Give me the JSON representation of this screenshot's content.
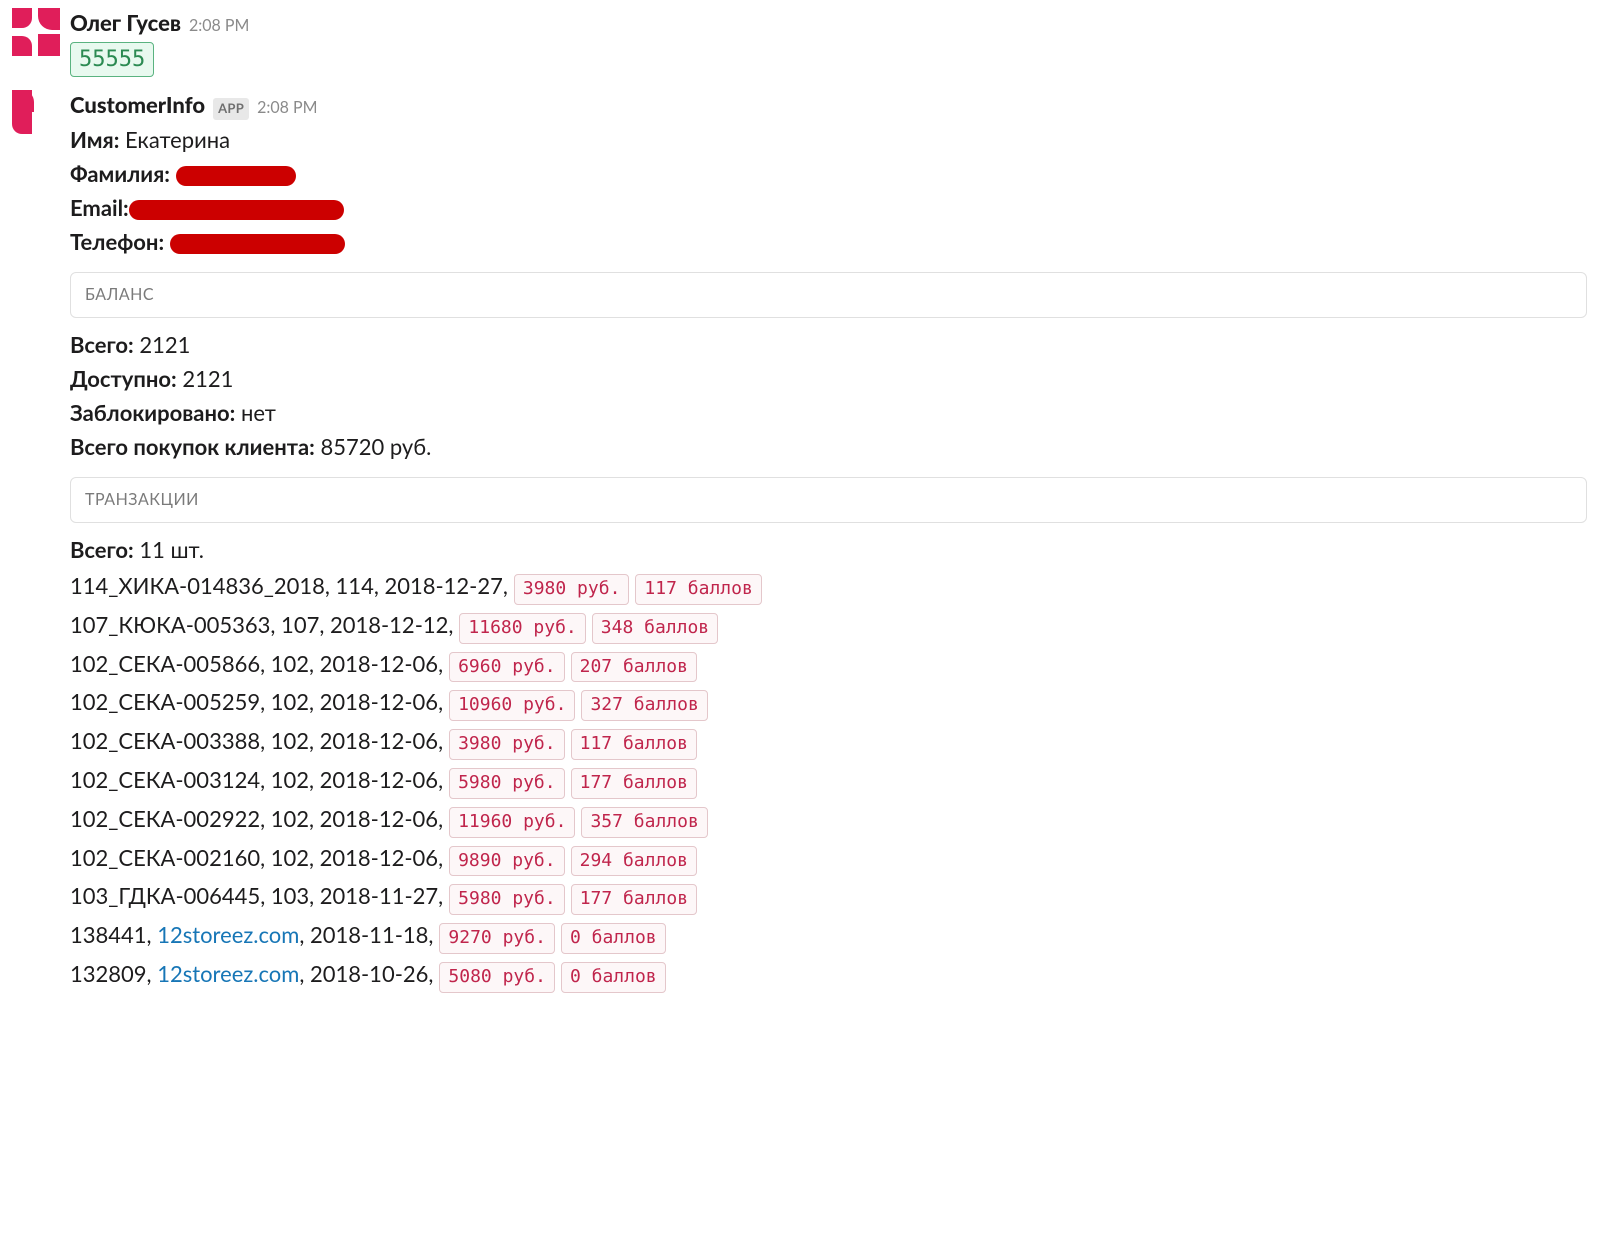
{
  "msg1": {
    "sender": "Олег Гусев",
    "time": "2:08 PM",
    "code": "55555"
  },
  "msg2": {
    "sender": "CustomerInfo",
    "app_badge": "APP",
    "time": "2:08 PM",
    "name_label": "Имя:",
    "name_value": "Екатерина",
    "surname_label": "Фамилия:",
    "email_label": "Email:",
    "phone_label": "Телефон:",
    "balance": {
      "heading": "БАЛАНС",
      "total_label": "Всего:",
      "total_value": "2121",
      "avail_label": "Доступно:",
      "avail_value": "2121",
      "blocked_label": "Заблокировано:",
      "blocked_value": "нет",
      "purchases_label": "Всего покупок клиента:",
      "purchases_value": "85720 руб."
    },
    "tx": {
      "heading": "ТРАНЗАКЦИИ",
      "total_label": "Всего:",
      "total_value": "11 шт.",
      "rows": [
        {
          "text": "114_ХИКА-014836_2018, 114, 2018-12-27,",
          "price": "3980 руб.",
          "points": "117 баллов"
        },
        {
          "text": "107_КЮКА-005363, 107, 2018-12-12,",
          "price": "11680 руб.",
          "points": "348 баллов"
        },
        {
          "text": "102_СЕКА-005866, 102, 2018-12-06,",
          "price": "6960 руб.",
          "points": "207 баллов"
        },
        {
          "text": "102_СЕКА-005259, 102, 2018-12-06,",
          "price": "10960 руб.",
          "points": "327 баллов"
        },
        {
          "text": "102_СЕКА-003388, 102, 2018-12-06,",
          "price": "3980 руб.",
          "points": "117 баллов"
        },
        {
          "text": "102_СЕКА-003124, 102, 2018-12-06,",
          "price": "5980 руб.",
          "points": "177 баллов"
        },
        {
          "text": "102_СЕКА-002922, 102, 2018-12-06,",
          "price": "11960 руб.",
          "points": "357 баллов"
        },
        {
          "text": "102_СЕКА-002160, 102, 2018-12-06,",
          "price": "9890 руб.",
          "points": "294 баллов"
        },
        {
          "text": "103_ГДКА-006445, 103, 2018-11-27,",
          "price": "5980 руб.",
          "points": "177 баллов"
        },
        {
          "text_a": "138441, ",
          "link": "12storeez.com",
          "text_b": ", 2018-11-18,",
          "price": "9270 руб.",
          "points": "0 баллов"
        },
        {
          "text_a": "132809, ",
          "link": "12storeez.com",
          "text_b": ", 2018-10-26,",
          "price": "5080 руб.",
          "points": "0 баллов"
        }
      ]
    }
  }
}
